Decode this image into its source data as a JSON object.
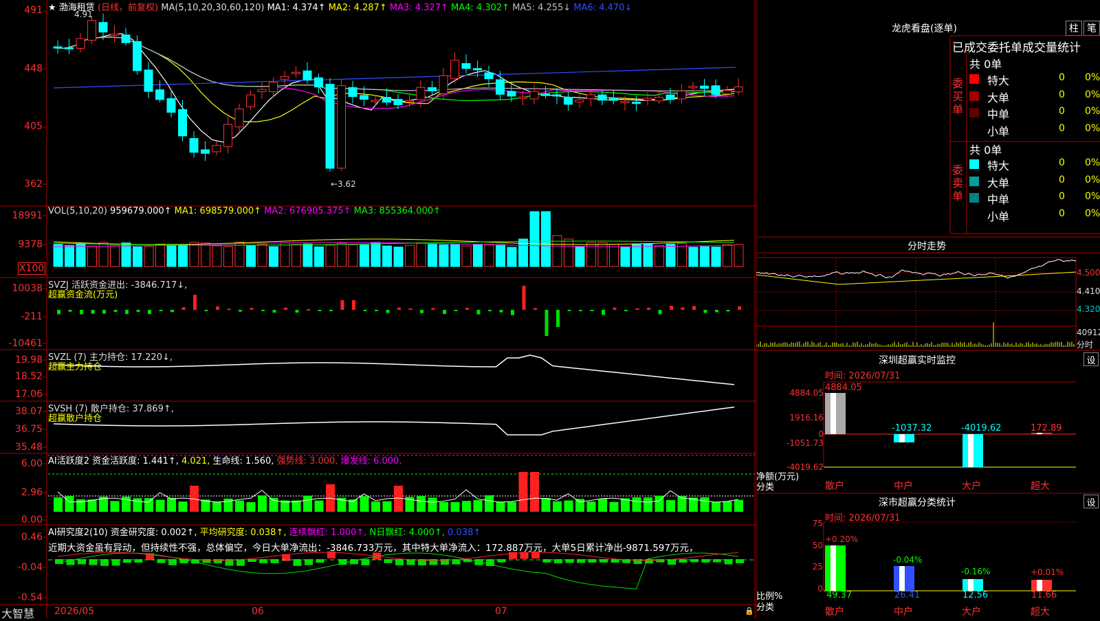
{
  "stock": {
    "star": "★",
    "name": "渤海租赁",
    "mode": "(日线，前复权)",
    "ma_label": "MA(5,10,20,30,60,120)",
    "ma": [
      {
        "label": "MA1: 4.374↑",
        "color": "#ffffff"
      },
      {
        "label": "MA2: 4.287↑",
        "color": "#ffff00"
      },
      {
        "label": "MA3: 4.327↑",
        "color": "#ff00ff"
      },
      {
        "label": "MA4: 4.302↑",
        "color": "#00ff00"
      },
      {
        "label": "MA5: 4.255↓",
        "color": "#c0c0c0"
      },
      {
        "label": "MA6: 4.470↓",
        "color": "#3050ff"
      }
    ],
    "high_marker": "4.91",
    "low_marker": "←3.62"
  },
  "axes": {
    "price": [
      "491",
      "448",
      "405",
      "362"
    ],
    "vol": [
      "18991",
      "9378",
      "X100"
    ],
    "svzj": [
      "10038",
      "-211",
      "-10461"
    ],
    "svzl": [
      "19.98",
      "18.52",
      "17.06"
    ],
    "svsh": [
      "38.07",
      "36.75",
      "35.48"
    ],
    "ai": [
      "6.00",
      "2.96",
      "0.00"
    ],
    "ai2": [
      "0.46",
      "-0.04",
      "-0.54"
    ]
  },
  "vol_header": {
    "name": "VOL(5,10,20)",
    "v": "959679.000↑",
    "ma1": "MA1: 698579.000↑",
    "ma2": "MA2: 676905.375↑",
    "ma3": "MA3: 855364.000↑"
  },
  "svzj_header": {
    "line1": "SVZJ  活跃资金进出: -3846.717↓,",
    "line2": "超赢资金流(万元)"
  },
  "svzl_header": {
    "line1": "SVZL (7) 主力持仓: 17.220↓,",
    "line2": "超赢主力持仓"
  },
  "svsh_header": {
    "line1": "SVSH (7) 散户持仓: 37.869↑,",
    "line2": "超赢散户持仓"
  },
  "ai_header": {
    "a": "AI活跃度2 资金活跃度: 1.441↑,",
    "b": "4.021,",
    "c": "生命线: 1.560,",
    "d": "强势线: 3.000,",
    "e": "爆发线: 6.000,"
  },
  "ai2_header": {
    "a": "AI研究度2(10) 资金研究度: 0.002↑,",
    "b": "平均研究度: 0.038↑,",
    "c": "连续飘红: 1.000↑,",
    "d": "N日飘红: 4.000↑,",
    "e": "0.038↑"
  },
  "ai2_text": "近期大资金虽有异动，但持续性不强，总体偏空，今日大单净流出：-3846.733万元，其中特大单净流入：172.887万元，大单5日累计净出-9871.597万元，",
  "date_axis": [
    "2026/05",
    "06",
    "07"
  ],
  "brand": "大智慧",
  "right": {
    "title": "龙虎看盘(逐单)",
    "btn1": "柱",
    "btn2": "笔",
    "tabs": "已成交委托单成交量统计",
    "buy_group": "委买单",
    "sell_group": "委卖单",
    "buy_total": "共 0单",
    "sell_total": "共 0单",
    "buy_rows": [
      {
        "name": "特大",
        "count": "0",
        "pct": "0%",
        "color": "#ff0000"
      },
      {
        "name": "大单",
        "count": "0",
        "pct": "0%",
        "color": "#a00000"
      },
      {
        "name": "中单",
        "count": "0",
        "pct": "0%",
        "color": "#600000"
      },
      {
        "name": "小单",
        "count": "0",
        "pct": "0%",
        "color": "#000000"
      }
    ],
    "sell_rows": [
      {
        "name": "特大",
        "count": "0",
        "pct": "0%",
        "color": "#00ffff"
      },
      {
        "name": "大单",
        "count": "0",
        "pct": "0%",
        "color": "#00a0a0"
      },
      {
        "name": "中单",
        "count": "0",
        "pct": "0%",
        "color": "#008080"
      },
      {
        "name": "小单",
        "count": "0",
        "pct": "0%",
        "color": "#000000"
      }
    ],
    "intraday_title": "分时走势",
    "intraday_axis": [
      "4.500",
      "4.410",
      "4.320",
      "40912",
      "分时"
    ],
    "monitor_title": "深圳超赢实时监控",
    "monitor_btn": "设",
    "monitor_time": "时间: 2026/07/31",
    "monitor_axis": [
      "4884.05",
      "1916.16",
      "0",
      "-1051.73",
      "-4019.62"
    ],
    "monitor_axis_label": "净额(万元)",
    "monitor_axis_label2": "分类",
    "monitor_values": [
      "4884.05",
      "-1037.32",
      "-4019.62",
      "172.89"
    ],
    "categories": [
      "散户",
      "中户",
      "大户",
      "超大"
    ],
    "class_title": "深市超赢分类统计",
    "class_btn": "设",
    "class_time": "时间: 2026/07/31",
    "class_axis": [
      "75",
      "50",
      "25",
      "0"
    ],
    "class_axis_label": "比例%",
    "class_axis_label2": "分类",
    "class_changes": [
      "+0.20%",
      "-0.04%",
      "-0.16%",
      "+0.01%"
    ],
    "class_values": [
      "49.37",
      "26.41",
      "12.56",
      "11.66"
    ]
  }
}
